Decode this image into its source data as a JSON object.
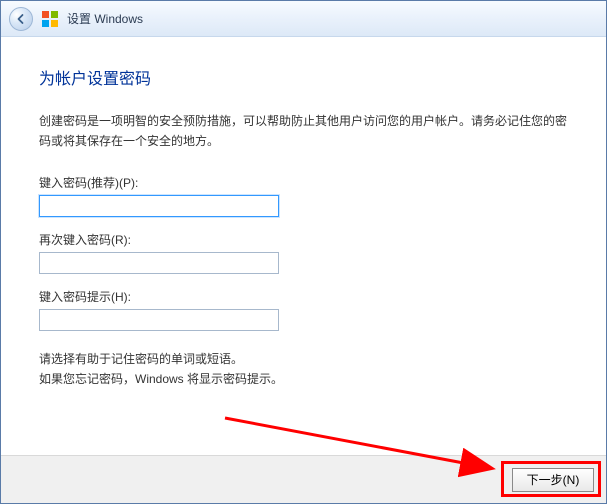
{
  "titlebar": {
    "title": "设置 Windows"
  },
  "main": {
    "heading": "为帐户设置密码",
    "description": "创建密码是一项明智的安全预防措施，可以帮助防止其他用户访问您的用户帐户。请务必记住您的密码或将其保存在一个安全的地方。",
    "fields": {
      "password": {
        "label": "键入密码(推荐)(P):",
        "value": ""
      },
      "confirm": {
        "label": "再次键入密码(R):",
        "value": ""
      },
      "hint": {
        "label": "键入密码提示(H):",
        "value": ""
      }
    },
    "hint_text_1": "请选择有助于记住密码的单词或短语。",
    "hint_text_2": "如果您忘记密码，Windows 将显示密码提示。"
  },
  "footer": {
    "next_label": "下一步(N)"
  }
}
